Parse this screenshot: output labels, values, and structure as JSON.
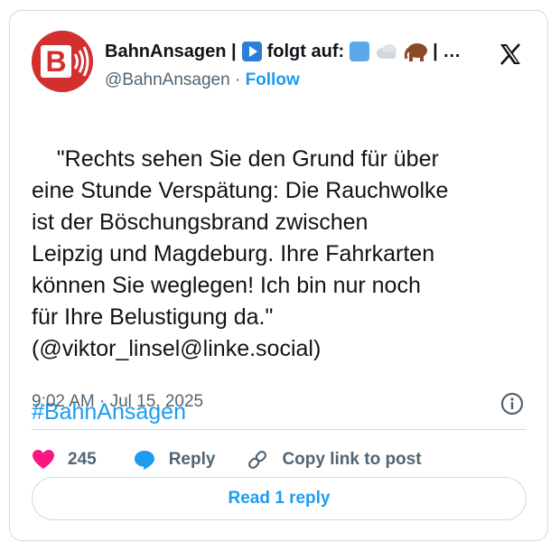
{
  "account": {
    "display_name_prefix": "BahnAnsagen |",
    "display_name_middle": "folgt auf:",
    "ellipsis": "| …",
    "handle": "@BahnAnsagen",
    "separator": " · ",
    "follow_label": "Follow"
  },
  "tweet": {
    "text": "\"Rechts sehen Sie den Grund für über\neine Stunde Verspätung: Die Rauchwolke\nist der Böschungsbrand zwischen\nLeipzig und Magdeburg. Ihre Fahrkarten\nkönnen Sie weglegen! Ich bin nur noch\nfür Ihre Belustigung da.\"\n(@viktor_linsel@linke.social)",
    "hashtag": "#BahnAnsagen",
    "timestamp": "9:02 AM · Jul 15, 2025"
  },
  "actions": {
    "like_count": "245",
    "reply_label": "Reply",
    "copy_label": "Copy link to post",
    "read_replies_label": "Read 1 reply"
  },
  "icons": [
    "bahn-logo-icon",
    "play-icon",
    "blue-square-icon",
    "cloud-icon",
    "mammoth-icon",
    "x-logo-icon",
    "info-icon",
    "heart-icon",
    "reply-bubble-icon",
    "link-icon"
  ],
  "colors": {
    "accent": "#1d9bf0",
    "like": "#f91880",
    "logo_red": "#d32f2f",
    "muted": "#536471"
  }
}
